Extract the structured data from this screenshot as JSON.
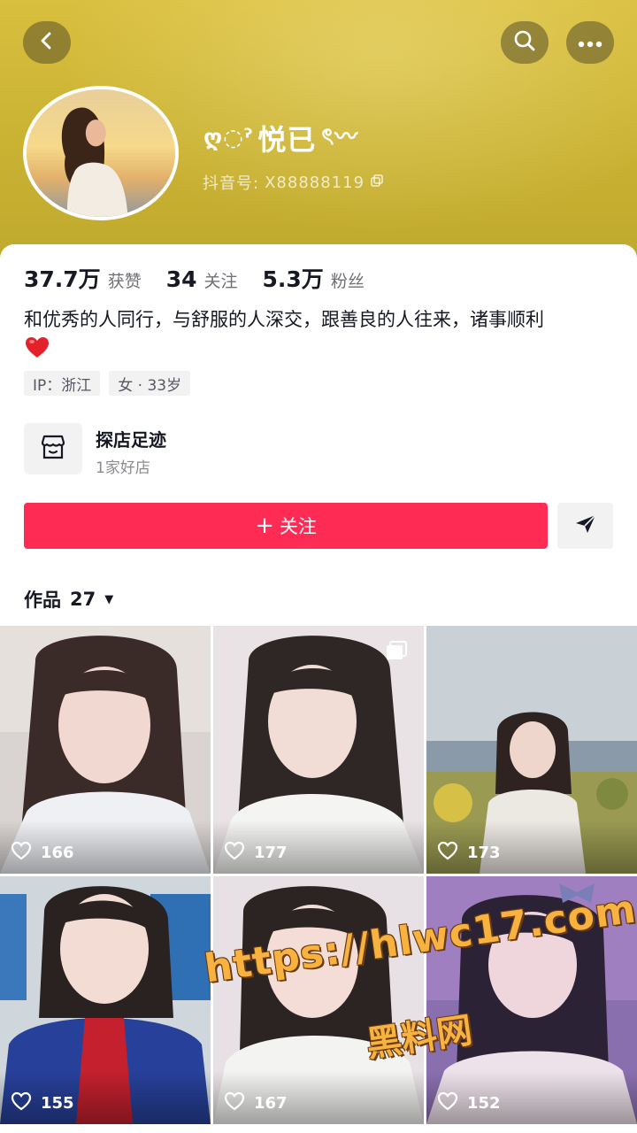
{
  "profile": {
    "nickname_prefix": "ღ◌ˀ",
    "nickname": "悦已",
    "nickname_suffix": "ৎ〰",
    "douyin_id_label": "抖音号:",
    "douyin_id": "X88888119"
  },
  "stats": [
    {
      "value": "37.7万",
      "label": "获赞"
    },
    {
      "value": "34",
      "label": "关注"
    },
    {
      "value": "5.3万",
      "label": "粉丝"
    }
  ],
  "bio": "和优秀的人同行，与舒服的人深交，跟善良的人往来，诸事顺利",
  "tags": [
    "IP：浙江",
    "女 · 33岁"
  ],
  "store": {
    "title": "探店足迹",
    "subtitle": "1家好店"
  },
  "actions": {
    "follow_label": "关注"
  },
  "works": {
    "label": "作品",
    "count": "27"
  },
  "grid": [
    {
      "likes": "166"
    },
    {
      "likes": "177"
    },
    {
      "likes": "173"
    },
    {
      "likes": "155"
    },
    {
      "likes": "167"
    },
    {
      "likes": "152"
    }
  ],
  "watermark": {
    "url": "https://hlwc17.com",
    "name": "黑料网"
  },
  "icons": {
    "back": "chevron-left-icon",
    "search": "search-icon",
    "more": "more-icon",
    "copy": "copy-icon",
    "heart_emoji": "red-heart-icon",
    "store": "store-icon",
    "share": "send-icon",
    "caret": "caret-down-icon",
    "like": "heart-outline-icon",
    "multi": "multi-image-icon"
  },
  "colors": {
    "accent": "#fe2c55",
    "banner": "#cdb535"
  }
}
